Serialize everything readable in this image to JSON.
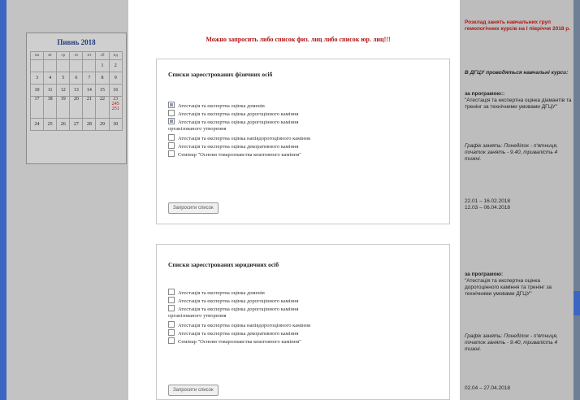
{
  "calendar": {
    "title": "Пивнь 2018",
    "weekdays": [
      "пн",
      "вт",
      "ср",
      "чт",
      "пт",
      "сб",
      "нд"
    ],
    "rows": [
      [
        "",
        "",
        "",
        "",
        "",
        "1",
        "2"
      ],
      [
        "3",
        "4",
        "5",
        "6",
        "7",
        "8",
        "9"
      ],
      [
        "10",
        "11",
        "12",
        "13",
        "14",
        "15",
        "16"
      ],
      [
        "17",
        "18",
        "19",
        "20",
        "21",
        "22",
        "23\n245\n251"
      ],
      [
        "24",
        "25",
        "26",
        "27",
        "28",
        "29",
        "30"
      ]
    ]
  },
  "headline": "Можно запросить либо список физ. лиц либо список юр. лиц!!!",
  "individuals": {
    "title": "Списки зареєстрованих фізичних осіб",
    "options": [
      {
        "label": "Атестація та експертна оцінка доменів",
        "checked": true
      },
      {
        "label": "Атестація та експертна оцінка дорогоцінного каміння",
        "checked": false
      },
      {
        "label": "Атестація та експертна оцінка дорогоцінного каміння",
        "label2": "організованого утворення",
        "checked": true
      },
      {
        "label": "Атестація та експертна оцінка напівдорогоцінного каміння",
        "checked": false
      },
      {
        "label": "Атестація та експертна оцінка декоративного каміння",
        "checked": false
      },
      {
        "label": "Семінар \"Основи товарознавства коштовного каміння\"",
        "checked": false
      }
    ],
    "button": "Запросити список"
  },
  "legal": {
    "title": "Списки зареєстрованих юридичних осіб",
    "options": [
      {
        "label": "Атестація та експертна оцінка доменів",
        "checked": false
      },
      {
        "label": "Атестація та експертна оцінка дорогоцінного каміння",
        "checked": false
      },
      {
        "label": "Атестація та експертна оцінка дорогоцінного каміння",
        "label2": "організованого утворення",
        "checked": false
      },
      {
        "label": "Атестація та експертна оцінка напівдорогоцінного каміння",
        "checked": false
      },
      {
        "label": "Атестація та експертна оцінка декоративного каміння",
        "checked": false
      },
      {
        "label": "Семінар \"Основи товарознавства коштовного каміння\"",
        "checked": false
      }
    ],
    "button": "Запросити список"
  },
  "sidebar": {
    "title": "Розклад занять навчальних груп гемологічних курсів на І півріччя 2018 р.",
    "intro": "В ДГЦУ проводяться навчальні курси:",
    "program1_label": "за програмою::",
    "program1_text": "\"Атестація та експертна оцінка діамантів та тренінг за технічними умовами ДГЦУ\"",
    "schedule1": "Графік занять: Понеділок - п'ятниця, початок занять - 9.40, тривалість 4 тижні.",
    "dates1": "22.01 – 16.02.2018\n12.03 – 06.04.2018",
    "program2_label": "за програмою:",
    "program2_text": "\"Атестація та експертна оцінка дорогоцінного каміння та тренінг за технічними умовами ДГЦУ\"",
    "schedule2": "Графік занять: Понеділок - п'ятниця, початок занять - 9.40, тривалість 4 тижні.",
    "dates2": "02.04 – 27.04.2018"
  }
}
